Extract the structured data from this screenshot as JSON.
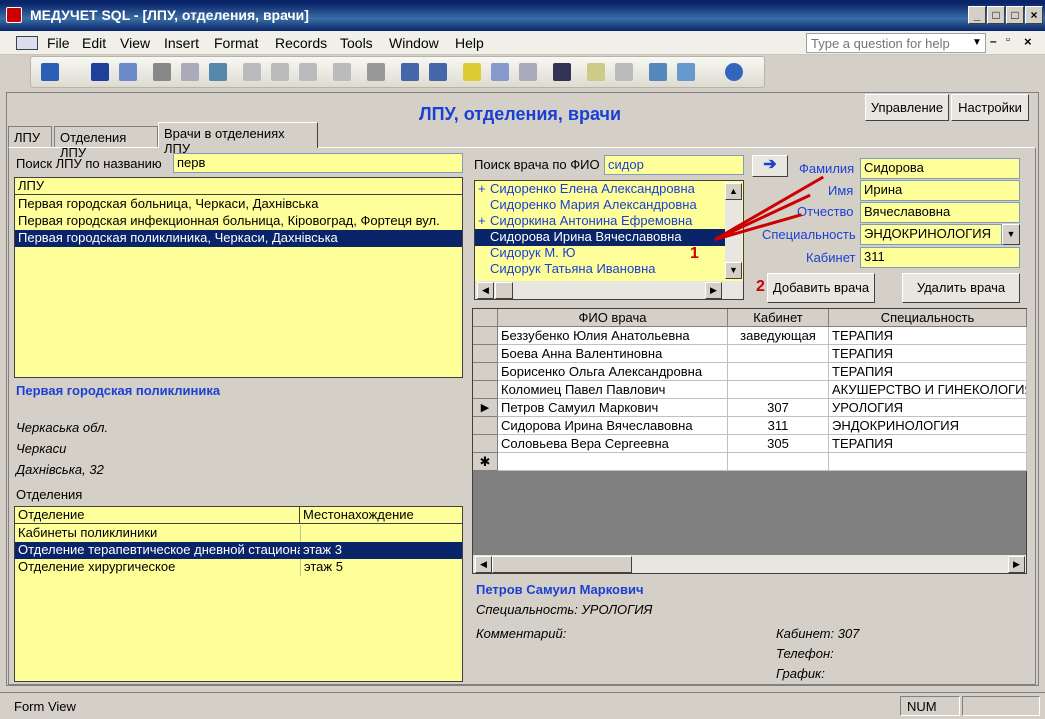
{
  "window": {
    "title": "МЕДУЧЕТ SQL - [ЛПУ, отделения, врачи]"
  },
  "menu": [
    "File",
    "Edit",
    "View",
    "Insert",
    "Format",
    "Records",
    "Tools",
    "Window",
    "Help"
  ],
  "help_placeholder": "Type a question for help",
  "header": {
    "title": "ЛПУ, отделения, врачи",
    "btn_manage": "Управление",
    "btn_settings": "Настройки"
  },
  "tabs": [
    "ЛПУ",
    "Отделения ЛПУ",
    "Врачи в отделениях ЛПУ"
  ],
  "lpu_search": {
    "label": "Поиск ЛПУ по названию",
    "value": "перв",
    "list_header": "ЛПУ",
    "items": [
      "Первая городская больница, Черкаси, Дахнівська",
      "Первая городская инфекционная больница, Кіровоград, Фортеця вул.",
      "Первая городская поликлиника, Черкаси, Дахнівська"
    ]
  },
  "lpu_detail": {
    "name": "Первая городская поликлиника",
    "region": "Черкаська обл.",
    "city": "Черкаси",
    "address": "Дахнiвська, 32"
  },
  "departments": {
    "title": "Отделения",
    "col1": "Отделение",
    "col2": "Местонахождение",
    "rows": [
      {
        "name": "Кабинеты поликлиники",
        "loc": ""
      },
      {
        "name": "Отделение терапевтическое дневной стационар",
        "loc": "этаж 3"
      },
      {
        "name": "Отделение хирургическое",
        "loc": "этаж 5"
      }
    ]
  },
  "doctor_search": {
    "label": "Поиск врача по ФИО",
    "value": "сидор",
    "items": [
      {
        "plus": "+",
        "name": "Сидоренко Елена Александровна"
      },
      {
        "plus": "",
        "name": "Сидоренко Мария Александровна"
      },
      {
        "plus": "+",
        "name": "Сидоркина Антонина Ефремовна"
      },
      {
        "plus": "",
        "name": "Сидорова Ирина Вячеславовна"
      },
      {
        "plus": "",
        "name": "Сидорук М. Ю"
      },
      {
        "plus": "",
        "name": "Сидорук Татьяна Ивановна"
      }
    ]
  },
  "doctor_fields": {
    "surname_label": "Фамилия",
    "surname": "Сидорова",
    "name_label": "Имя",
    "name": "Ирина",
    "patronymic_label": "Отчество",
    "patronymic": "Вячеславовна",
    "spec_label": "Специальность",
    "spec": "ЭНДОКРИНОЛОГИЯ",
    "cabinet_label": "Кабинет",
    "cabinet": "311"
  },
  "markers": {
    "m1": "1",
    "m2": "2"
  },
  "buttons": {
    "add": "Добавить врача",
    "delete": "Удалить врача"
  },
  "grid": {
    "col_fio": "ФИО врача",
    "col_cab": "Кабинет",
    "col_spec": "Специальность",
    "rows": [
      {
        "fio": "Беззубенко Юлия Анатольевна",
        "cab": "заведующая",
        "spec": "ТЕРАПИЯ"
      },
      {
        "fio": "Боева Анна Валентиновна",
        "cab": "",
        "spec": "ТЕРАПИЯ"
      },
      {
        "fio": "Борисенко Ольга Александровна",
        "cab": "",
        "spec": "ТЕРАПИЯ"
      },
      {
        "fio": "Коломиец Павел Павлович",
        "cab": "",
        "spec": "АКУШЕРСТВО И ГИНЕКОЛОГИЯ"
      },
      {
        "fio": "Петров Самуил Маркович",
        "cab": "307",
        "spec": "УРОЛОГИЯ"
      },
      {
        "fio": "Сидорова Ирина Вячеславовна",
        "cab": "311",
        "spec": "ЭНДОКРИНОЛОГИЯ"
      },
      {
        "fio": "Соловьева Вера Сергеевна",
        "cab": "305",
        "spec": "ТЕРАПИЯ"
      }
    ]
  },
  "doctor_detail": {
    "name": "Петров Самуил Маркович",
    "spec": "Специальность: УРОЛОГИЯ",
    "comment": "Комментарий:",
    "cabinet": "Кабинет: 307",
    "phone": "Телефон:",
    "schedule": "График:"
  },
  "status": {
    "view": "Form View",
    "num": "NUM"
  }
}
